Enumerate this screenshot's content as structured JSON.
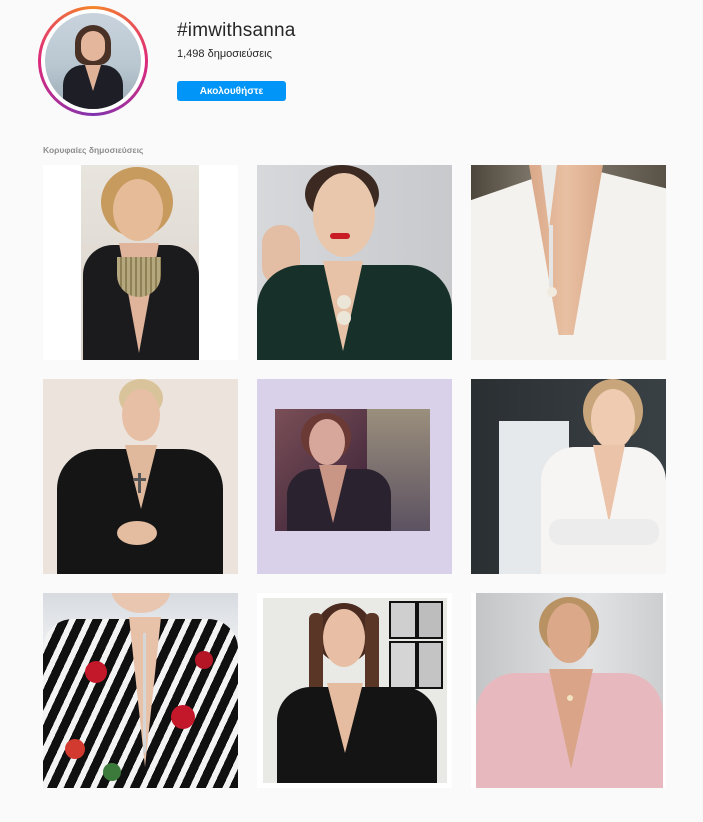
{
  "hashtag": {
    "title": "#imwithsanna",
    "post_count": "1,498 δημοσιεύσεις",
    "follow_label": "Ακολουθήστε"
  },
  "section": {
    "top_posts_label": "Κορυφαίες δημοσιεύσεις"
  },
  "colors": {
    "background": "#fafafa",
    "follow_button": "#0095f6",
    "muted_text": "#8e8e8e"
  },
  "posts": [
    {
      "subject": "woman-black-blazer-statement-necklace"
    },
    {
      "subject": "woman-red-lips-dark-green-top"
    },
    {
      "subject": "white-blazer-pendant-necklace"
    },
    {
      "subject": "woman-black-blazer-cross-necklace"
    },
    {
      "subject": "framed-photo-woman-dark-jacket"
    },
    {
      "subject": "woman-white-blazer-arms-crossed"
    },
    {
      "subject": "floral-striped-blazer"
    },
    {
      "subject": "woman-black-blazer-framed-prints"
    },
    {
      "subject": "woman-pink-blazer"
    }
  ]
}
